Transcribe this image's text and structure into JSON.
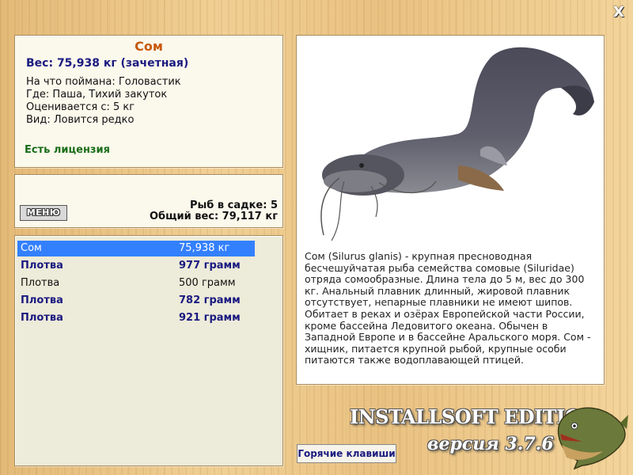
{
  "window": {
    "close_glyph": "X"
  },
  "fish": {
    "name": "Сом",
    "weight_line": "Вес: 75,938 кг (зачетная)",
    "details": [
      "На что поймана: Головастик",
      "Где: Паша, Тихий закуток",
      "Оценивается с: 5 кг",
      "Вид: Ловится редко"
    ],
    "license": "Есть лицензия",
    "description": "Сом (Silurus glanis) - крупная пресноводная бесчешуйчатая рыба семейства сомовые (Siluridae) отряда сомообразные. Длина тела до 5 м, вес до 300 кг. Анальный плавник длинный, жировой плавник отсутствует, непарные плавники не имеют шипов. Обитает в реках и озёрах Европейской части России, кроме бассейна Ледовитого океана. Обычен в Западной Европе и в бассейне Аральского моря. Сом - хищник, питается крупной рыбой, крупные особи питаются также водоплавающей птицей."
  },
  "keepnet": {
    "menu_label": "МЕНЮ",
    "count_line": "Рыб в садке: 5",
    "total_line": "Общий вес: 79,117 кг"
  },
  "catches": [
    {
      "name": "Сом",
      "weight": "75,938 кг",
      "style": "sel"
    },
    {
      "name": "Плотва",
      "weight": "977 грамм",
      "style": "hi"
    },
    {
      "name": "Плотва",
      "weight": "500 грамм",
      "style": "plain"
    },
    {
      "name": "Плотва",
      "weight": "782 грамм",
      "style": "hi"
    },
    {
      "name": "Плотва",
      "weight": "921 грамм",
      "style": "hi"
    }
  ],
  "hotkeys_label": "Горячие клавиши",
  "branding": {
    "edition": "INSTALLSOFT EDITION",
    "version": "версия 3.7.6"
  },
  "colors": {
    "title": "#c85a0c",
    "weight": "#1a1a80",
    "license": "#1a6e1a",
    "selection": "#3380ff"
  },
  "icons": {
    "close": "close-icon",
    "fish_picture": "catfish-icon",
    "logo": "pike-logo-icon"
  }
}
